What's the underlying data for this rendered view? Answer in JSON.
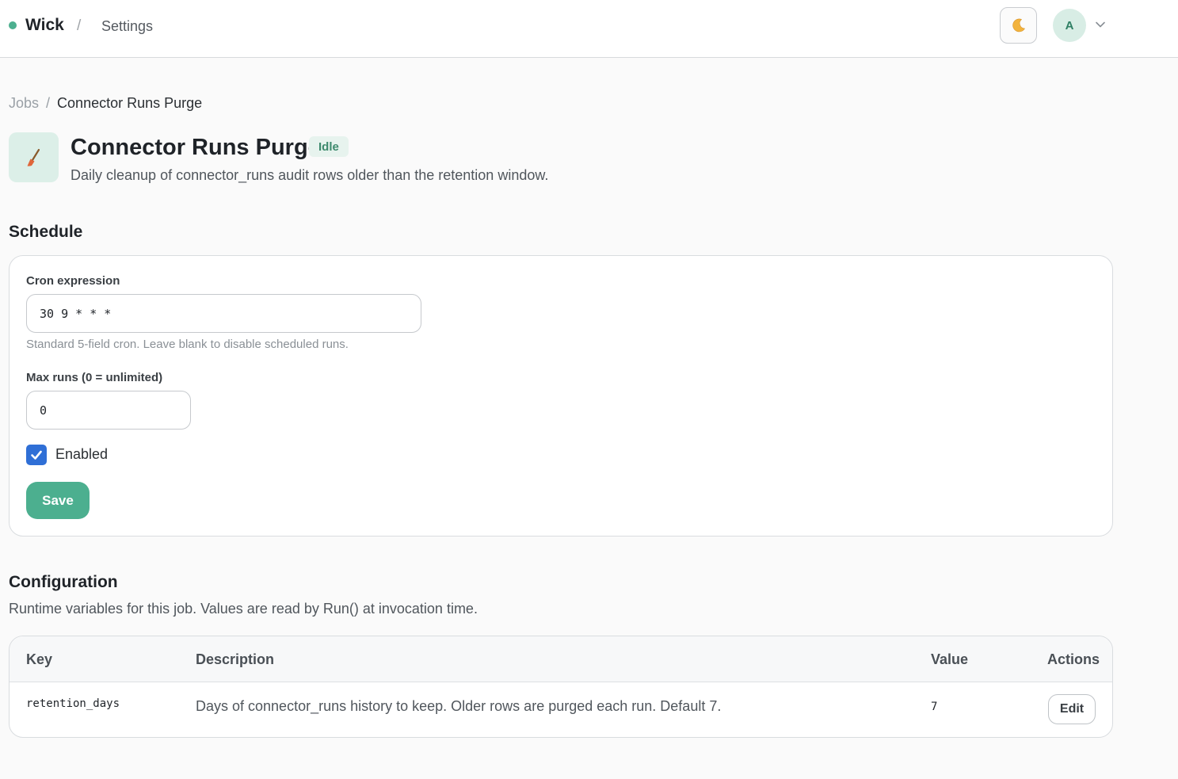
{
  "header": {
    "brand": "Wick",
    "separator": "/",
    "section": "Settings",
    "avatar_initial": "A"
  },
  "breadcrumb": {
    "parent": "Jobs",
    "separator": "/",
    "current": "Connector Runs Purge"
  },
  "job": {
    "title": "Connector Runs Purge",
    "status": "Idle",
    "description": "Daily cleanup of connector_runs audit rows older than the retention window."
  },
  "schedule": {
    "title": "Schedule",
    "cron_label": "Cron expression",
    "cron_value": "30 9 * * *",
    "cron_hint": "Standard 5-field cron. Leave blank to disable scheduled runs.",
    "max_runs_label": "Max runs (0 = unlimited)",
    "max_runs_value": "0",
    "enabled_label": "Enabled",
    "enabled": true,
    "save_label": "Save"
  },
  "configuration": {
    "title": "Configuration",
    "subtitle": "Runtime variables for this job. Values are read by Run() at invocation time.",
    "columns": {
      "key": "Key",
      "description": "Description",
      "value": "Value",
      "actions": "Actions"
    },
    "rows": [
      {
        "key": "retention_days",
        "description": "Days of connector_runs history to keep. Older rows are purged each run. Default 7.",
        "value": "7",
        "action_label": "Edit"
      }
    ]
  },
  "colors": {
    "accent": "#4caf8f",
    "checkbox": "#2f6fd6",
    "status_badge_bg": "#e7f3ee"
  },
  "icons": {
    "theme_toggle": "moon-icon",
    "job": "broom-icon",
    "avatar_menu": "chevron-down-icon",
    "checkbox": "checkmark-icon"
  }
}
